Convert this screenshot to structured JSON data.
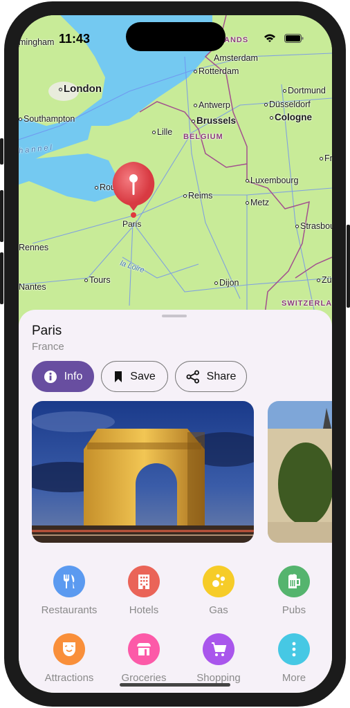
{
  "status_bar": {
    "time": "11:43",
    "icons": [
      "wifi-icon",
      "battery-icon"
    ]
  },
  "map": {
    "labels": {
      "birmingham": "mingham",
      "london": "London",
      "southampton": "Southampton",
      "channel": "hannel",
      "netherlands": "ERLANDS",
      "amsterdam": "Amsterdam",
      "rotterdam": "Rotterdam",
      "antwerp": "Antwerp",
      "brussels": "Brussels",
      "belgium": "BELGIUM",
      "lille": "Lille",
      "dortmund": "Dortmund",
      "dusseldorf": "Düsseldorf",
      "cologne": "Cologne",
      "fr": "Fr",
      "rouen": "Rou",
      "paris": "Paris",
      "reims": "Reims",
      "luxembourg": "Luxembourg",
      "metz": "Metz",
      "strasbourg": "Strasbou",
      "rennes": "Rennes",
      "loire": "la Loire",
      "tours": "Tours",
      "nantes": "Nantes",
      "dijon": "Dijon",
      "zurich": "Zü",
      "switzerland": "SWITZERLA"
    },
    "pin_color": "#e8474f"
  },
  "sheet": {
    "title": "Paris",
    "subtitle": "France",
    "buttons": [
      {
        "label": "Info",
        "icon": "info-icon"
      },
      {
        "label": "Save",
        "icon": "bookmark-icon"
      },
      {
        "label": "Share",
        "icon": "share-icon"
      }
    ],
    "accent": "#684ea0",
    "categories": [
      {
        "label": "Restaurants",
        "icon": "fork-knife-icon",
        "color": "#5b9af0"
      },
      {
        "label": "Hotels",
        "icon": "hotel-icon",
        "color": "#ea6458"
      },
      {
        "label": "Gas",
        "icon": "gas-icon",
        "color": "#f6cc28"
      },
      {
        "label": "Pubs",
        "icon": "beer-icon",
        "color": "#55b46e"
      },
      {
        "label": "Attractions",
        "icon": "mask-icon",
        "color": "#f98f3a"
      },
      {
        "label": "Groceries",
        "icon": "store-icon",
        "color": "#fc5aa8"
      },
      {
        "label": "Shopping",
        "icon": "cart-icon",
        "color": "#a956ec"
      },
      {
        "label": "More",
        "icon": "more-icon",
        "color": "#46c8e4"
      }
    ]
  }
}
